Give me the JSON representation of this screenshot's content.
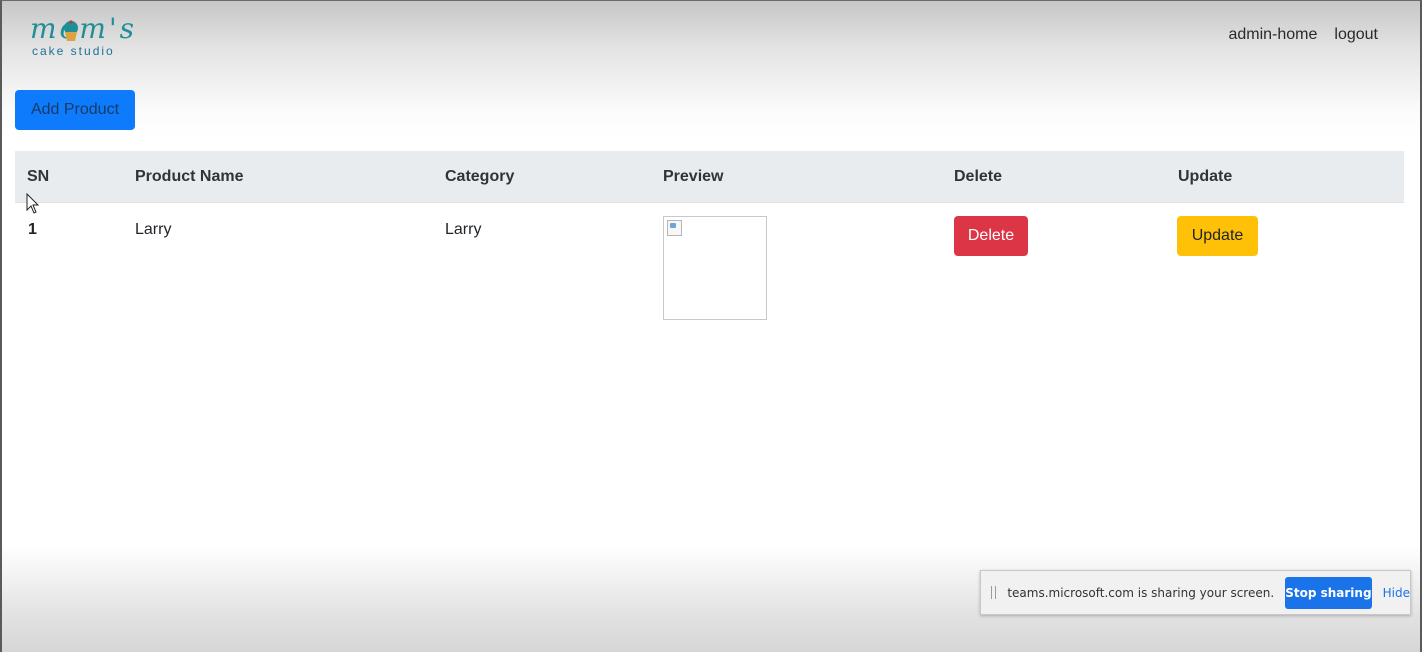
{
  "logo": {
    "script_text": "mom's",
    "subtitle": "cake studio"
  },
  "nav": {
    "items": [
      {
        "label": "admin-home"
      },
      {
        "label": "logout"
      }
    ]
  },
  "toolbar": {
    "add_product_label": "Add Product"
  },
  "table": {
    "headers": [
      "SN",
      "Product Name",
      "Category",
      "Preview",
      "Delete",
      "Update"
    ],
    "rows": [
      {
        "sn": "1",
        "product_name": "Larry",
        "category": "Larry",
        "delete_label": "Delete",
        "update_label": "Update"
      }
    ]
  },
  "share_bar": {
    "message": "teams.microsoft.com is sharing your screen.",
    "stop_label": "Stop sharing",
    "hide_label": "Hide"
  },
  "colors": {
    "primary": "#0d7bfc",
    "danger": "#dc3545",
    "warning": "#ffc107",
    "share_blue": "#1a73e8",
    "logo_teal": "#1f8f95"
  }
}
